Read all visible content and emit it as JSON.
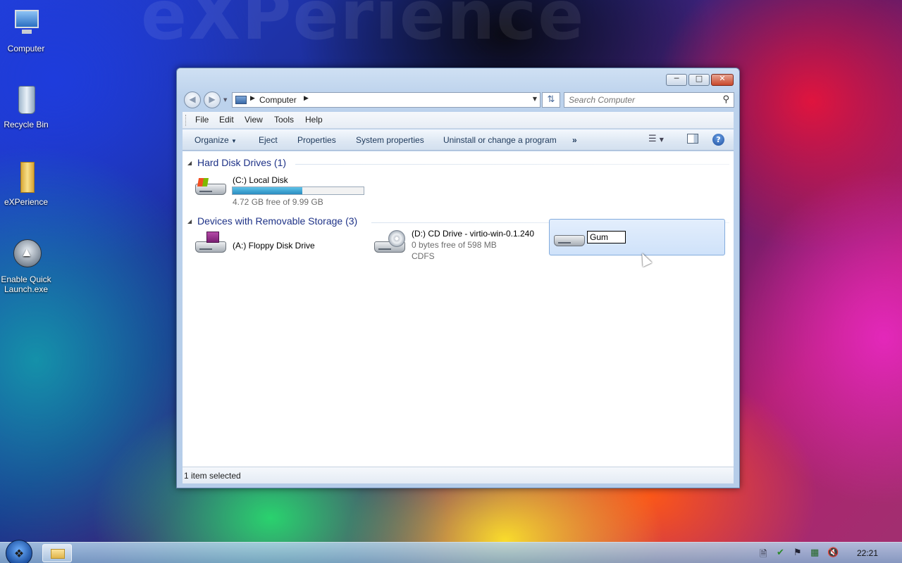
{
  "desktop": {
    "watermark": "eXPerience",
    "icons": [
      {
        "label": "Computer"
      },
      {
        "label": "Recycle Bin"
      },
      {
        "label": "eXPerience"
      },
      {
        "label": "Enable Quick Launch.exe"
      }
    ]
  },
  "window": {
    "address": {
      "location": "Computer"
    },
    "search": {
      "placeholder": "Search Computer"
    },
    "menu": [
      "File",
      "Edit",
      "View",
      "Tools",
      "Help"
    ],
    "commands": [
      "Organize",
      "Eject",
      "Properties",
      "System properties",
      "Uninstall or change a program"
    ],
    "groups": {
      "hdd_title": "Hard Disk Drives (1)",
      "removable_title": "Devices with Removable Storage (3)"
    },
    "drives": {
      "c": {
        "name": "(C:) Local Disk",
        "free": "4.72 GB free of 9.99 GB",
        "used_fraction": 0.53
      },
      "a": {
        "name": "(A:) Floppy Disk Drive"
      },
      "d": {
        "name": "(D:) CD Drive - virtio-win-0.1.240",
        "free": "0 bytes free of 598 MB",
        "fs": "CDFS"
      },
      "renaming": {
        "value": "Gum"
      }
    },
    "status": "1 item selected"
  },
  "taskbar": {
    "clock": "22:21"
  },
  "colors": {
    "progress_fill": "#2a8cc0",
    "group_title": "#1e3287",
    "selection": "#cfe2fa"
  }
}
